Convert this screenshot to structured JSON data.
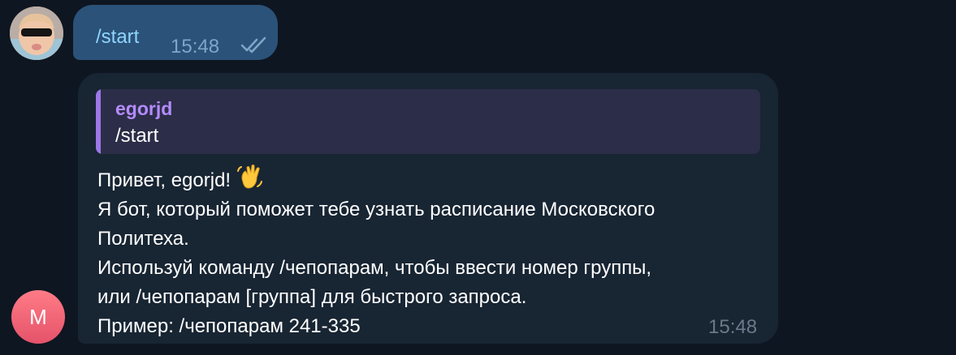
{
  "chat": {
    "outgoing": {
      "text": "/start",
      "time": "15:48",
      "status_icon": "double-check-icon"
    },
    "incoming": {
      "sender_avatar_letter": "M",
      "reply": {
        "author": "egorjd",
        "text": "/start"
      },
      "lines": [
        "Привет, egorjd!",
        "Я бот, который поможет тебе узнать расписание Московского",
        "Политеха.",
        "Используй команду /чепопарам, чтобы ввести номер группы,",
        "или /чепопарам [группа] для быстрого запроса.",
        "Пример: /чепопарам 241-335"
      ],
      "emoji": "waving-hand-icon",
      "time": "15:48"
    }
  },
  "colors": {
    "background": "#0e1621",
    "outgoing_bubble": "#2b5278",
    "incoming_bubble": "#182533",
    "reply_bar": "#9b78e6",
    "reply_author": "#b48cff",
    "bot_avatar": "#e5536a"
  }
}
